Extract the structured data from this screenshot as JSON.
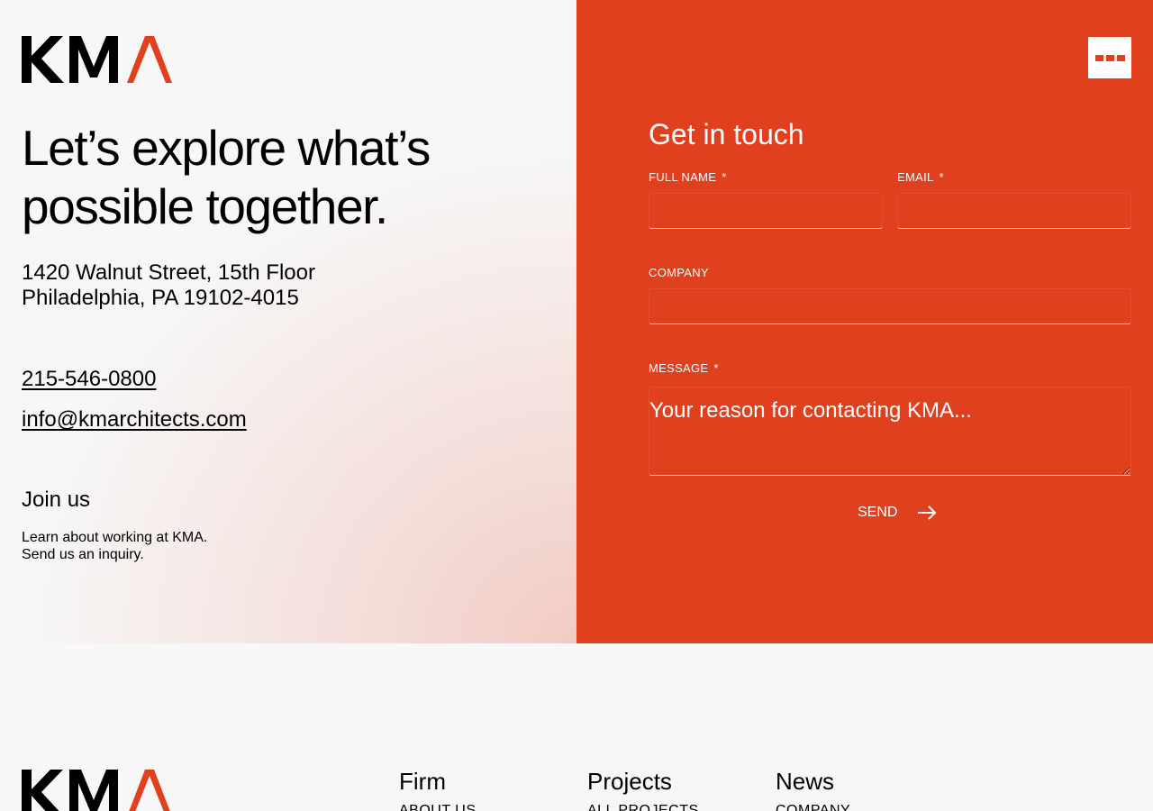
{
  "brand": {
    "logo_text": "KMA",
    "accent_color": "#e0401e",
    "logo_color": "#000000"
  },
  "hero": {
    "headline": "Let’s explore what’s possible together.",
    "address_line1": "1420 Walnut Street, 15th Floor",
    "address_line2": "Philadelphia, PA 19102-4015",
    "phone": "215-546-0800",
    "email": "info@kmarchitects.com"
  },
  "join": {
    "title": "Join us",
    "line1": "Learn about working at KMA.",
    "line2": "Send us an inquiry."
  },
  "header": {
    "menu_icon": "menu-dots-icon"
  },
  "form": {
    "title": "Get in touch",
    "required_mark": "*",
    "full_name_label": "FULL NAME",
    "full_name_value": "",
    "email_label": "EMAIL",
    "email_value": "",
    "company_label": "COMPANY",
    "company_value": "",
    "message_label": "MESSAGE",
    "message_placeholder": "Your reason for contacting KMA...",
    "send_label": "SEND",
    "send_icon": "arrow-right-icon"
  },
  "footer": {
    "columns": [
      {
        "title": "Firm",
        "first_link": "ABOUT US"
      },
      {
        "title": "Projects",
        "first_link": "ALL PROJECTS"
      },
      {
        "title": "News",
        "first_link": "COMPANY"
      }
    ]
  }
}
